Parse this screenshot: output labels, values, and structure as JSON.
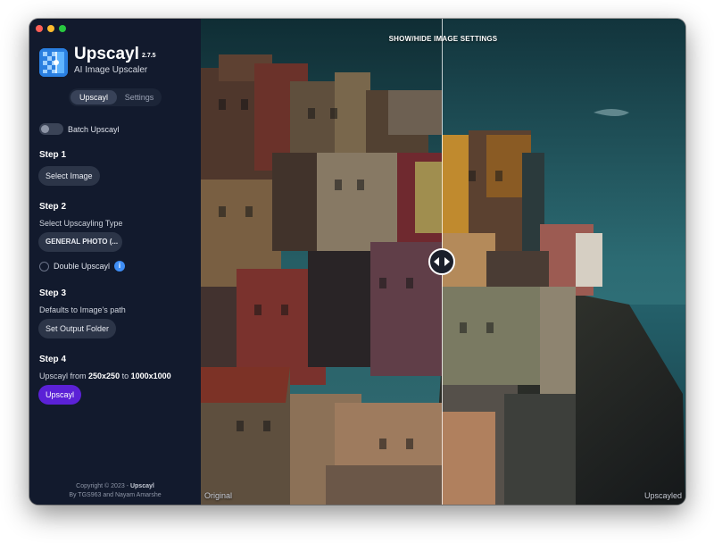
{
  "app": {
    "name": "Upscayl",
    "version": "2.7.5",
    "subtitle": "AI Image Upscaler"
  },
  "tabs": [
    {
      "label": "Upscayl",
      "active": true
    },
    {
      "label": "Settings",
      "active": false
    }
  ],
  "batch": {
    "label": "Batch Upscayl",
    "enabled": false
  },
  "step1": {
    "title": "Step 1",
    "button": "Select Image"
  },
  "step2": {
    "title": "Step 2",
    "subtitle": "Select Upscayling Type",
    "selected_model": "GENERAL PHOTO (...",
    "double_label": "Double Upscayl",
    "double_checked": false
  },
  "step3": {
    "title": "Step 3",
    "subtitle": "Defaults to Image's path",
    "button": "Set Output Folder"
  },
  "step4": {
    "title": "Step 4",
    "text_prefix": "Upscayl from",
    "from_size": "250x250",
    "text_mid": "to",
    "to_size": "1000x1000",
    "button": "Upscayl"
  },
  "footer": {
    "line1_prefix": "Copyright © 2023 -",
    "line1_app": "Upscayl",
    "line2": "By TGS963 and Nayam Amarshe"
  },
  "viewer": {
    "toggle_settings": "SHOW/HIDE IMAGE SETTINGS",
    "label_left": "Original",
    "label_right": "Upscayled",
    "split_fraction": 0.5
  },
  "icons": {
    "info": "i",
    "handle": "arrows-left-right-icon"
  },
  "colors": {
    "accent": "#5b21d6",
    "sidebar": "#121a2d",
    "info": "#3e8df5"
  }
}
